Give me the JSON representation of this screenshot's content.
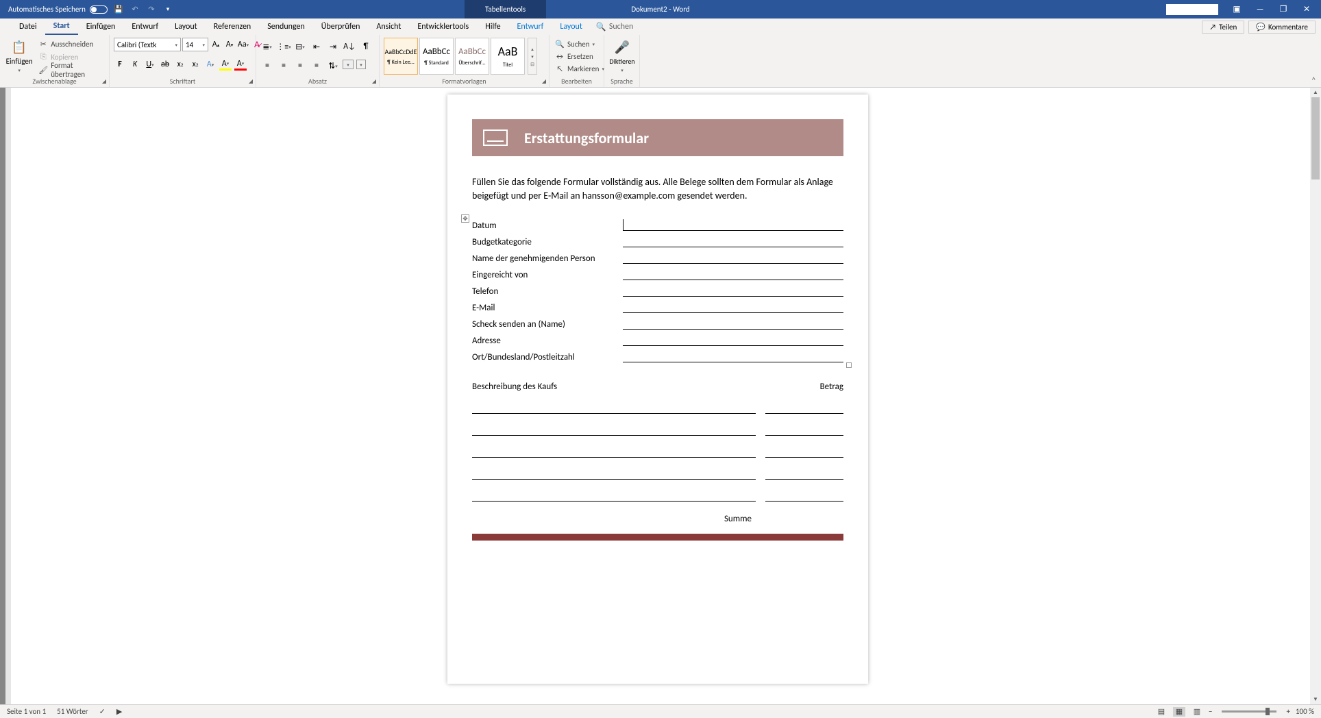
{
  "title": {
    "autosave": "Automatisches Speichern",
    "doc": "Dokument2 - Word",
    "tabletools": "Tabellentools"
  },
  "menu": {
    "datei": "Datei",
    "start": "Start",
    "einfuegen": "Einfügen",
    "entwurf": "Entwurf",
    "layout": "Layout",
    "referenzen": "Referenzen",
    "sendungen": "Sendungen",
    "ueberpruefen": "Überprüfen",
    "ansicht": "Ansicht",
    "entwicklertools": "Entwicklertools",
    "hilfe": "Hilfe",
    "ctx_entwurf": "Entwurf",
    "ctx_layout": "Layout",
    "suchen": "Suchen",
    "teilen": "Teilen",
    "kommentare": "Kommentare"
  },
  "ribbon": {
    "clipboard": {
      "einfuegen": "Einfügen",
      "ausschneiden": "Ausschneiden",
      "kopieren": "Kopieren",
      "format": "Format übertragen",
      "label": "Zwischenablage"
    },
    "font": {
      "name": "Calibri (Textk",
      "size": "14",
      "label": "Schriftart"
    },
    "paragraph": {
      "label": "Absatz"
    },
    "styles": {
      "s0": "AaBbCcDdE",
      "s0n": "¶ Kein Lee...",
      "s1": "AaBbCc",
      "s1n": "¶ Standard",
      "s2": "AaBbCc",
      "s2n": "Überschrif...",
      "s3": "AaB",
      "s3n": "Titel",
      "label": "Formatvorlagen"
    },
    "edit": {
      "suchen": "Suchen",
      "ersetzen": "Ersetzen",
      "markieren": "Markieren",
      "label": "Bearbeiten"
    },
    "dictate": {
      "label": "Diktieren",
      "group": "Sprache"
    }
  },
  "doc": {
    "header": "Erstattungsformular",
    "instr": "Füllen Sie das folgende Formular vollständig aus.  Alle Belege sollten dem Formular als Anlage beigefügt und per E-Mail an hansson@example.com gesendet werden.",
    "fields": {
      "datum": "Datum",
      "budget": "Budgetkategorie",
      "genehm": "Name der genehmigenden Person",
      "eingereicht": "Eingereicht von",
      "telefon": "Telefon",
      "email": "E-Mail",
      "scheck": "Scheck senden an (Name)",
      "adresse": "Adresse",
      "ort": "Ort/Bundesland/Postleitzahl"
    },
    "purchase": {
      "desc": "Beschreibung des Kaufs",
      "amount": "Betrag",
      "sum": "Summe"
    }
  },
  "status": {
    "page": "Seite 1 von 1",
    "words": "51 Wörter",
    "zoom": "100 %"
  }
}
